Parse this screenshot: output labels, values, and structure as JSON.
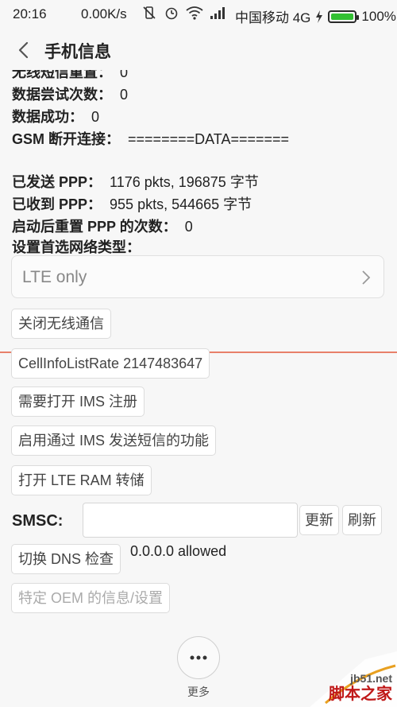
{
  "status_bar": {
    "time": "20:16",
    "speed": "0.00K/s",
    "carrier": "中国移动 4G",
    "battery": "100%",
    "battery_level": 1.0
  },
  "header": {
    "title": "手机信息"
  },
  "info": [
    {
      "label": "无线短信重置：",
      "value": "0"
    },
    {
      "label": "数据尝试次数：",
      "value": "0"
    },
    {
      "label": "数据成功：",
      "value": "0"
    },
    {
      "label": "GSM 断开连接：",
      "value": "========DATA======="
    },
    {
      "label": "已发送 PPP：",
      "value": "1176 pkts, 196875 字节"
    },
    {
      "label": "已收到 PPP：",
      "value": "955 pkts, 544665 字节"
    },
    {
      "label": "启动后重置 PPP 的次数：",
      "value": "0"
    },
    {
      "label": "设置首选网络类型：",
      "value": ""
    }
  ],
  "network_type": {
    "selected": "LTE only"
  },
  "buttons": {
    "radio_off": "关闭无线通信",
    "cellinfo_rate": "CellInfoListRate 2147483647",
    "ims_register": "需要打开 IMS 注册",
    "ims_sms": "启用通过 IMS 发送短信的功能",
    "lte_ram_dump": "打开 LTE RAM 转储",
    "dns_check": "切换 DNS 检查",
    "oem_settings": "特定 OEM 的信息/设置"
  },
  "smsc": {
    "label": "SMSC:",
    "value": "",
    "update": "更新",
    "refresh": "刷新"
  },
  "dns_status": "0.0.0.0 allowed",
  "more": {
    "label": "更多"
  },
  "watermark": {
    "site": "jb51.net",
    "name": "脚本之家"
  },
  "colors": {
    "accent_red": "#e8806a",
    "battery_green": "#33c033"
  }
}
